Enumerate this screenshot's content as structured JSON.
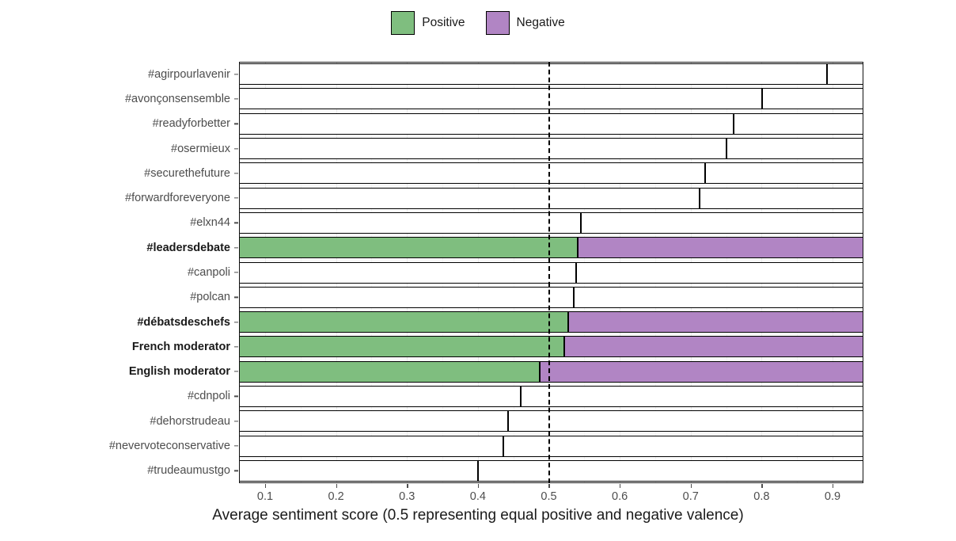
{
  "legend": {
    "items": [
      {
        "label": "Positive",
        "color": "#7fbe7f",
        "key": "positive-key"
      },
      {
        "label": "Negative",
        "color": "#b185c4",
        "key": "negative-key"
      }
    ]
  },
  "axis": {
    "x_title": "Average sentiment score (0.5 representing equal positive and negative valence)",
    "x_ticks": [
      "0.1",
      "0.2",
      "0.3",
      "0.4",
      "0.5",
      "0.6",
      "0.7",
      "0.8",
      "0.9"
    ],
    "x_tick_values": [
      0.1,
      0.2,
      0.3,
      0.4,
      0.5,
      0.6,
      0.7,
      0.8,
      0.9
    ],
    "x_min": 0.0632,
    "x_max": 0.9435,
    "reference_line": 0.5
  },
  "chart_data": {
    "type": "bar",
    "orientation": "horizontal",
    "stacked": true,
    "title": "",
    "subtitle": "",
    "xlabel": "Average sentiment score (0.5 representing equal positive and negative valence)",
    "ylabel": "",
    "xlim": [
      0.0632,
      0.9435
    ],
    "grid": true,
    "legend_position": "top",
    "annotations": [
      {
        "type": "vline",
        "value": 0.5,
        "style": "dashed",
        "color": "#000000"
      }
    ],
    "categories": [
      "#agirpourlavenir",
      "#avonçonsensemble",
      "#readyforbetter",
      "#osermieux",
      "#securethefuture",
      "#forwardforeveryone",
      "#elxn44",
      "#leadersdebate",
      "#canpoli",
      "#polcan",
      "#débatsdeschefs",
      "French moderator",
      "English moderator",
      "#cdnpoli",
      "#dehorstrudeau",
      "#nevervoteconservative",
      "#trudeaumustgo"
    ],
    "series": [
      {
        "name": "Positive",
        "color": "#7fbe7f",
        "values": [
          0.892,
          0.801,
          0.76,
          0.75,
          0.72,
          0.713,
          0.545,
          0.541,
          0.539,
          0.535,
          0.527,
          0.522,
          0.487,
          0.46,
          0.443,
          0.436,
          0.4
        ]
      },
      {
        "name": "Negative",
        "color": "#b185c4",
        "values": [
          0.108,
          0.199,
          0.24,
          0.25,
          0.28,
          0.287,
          0.455,
          0.459,
          0.461,
          0.465,
          0.473,
          0.478,
          0.513,
          0.54,
          0.557,
          0.564,
          0.6
        ]
      }
    ],
    "highlighted_categories": [
      "#leadersdebate",
      "#débatsdeschefs",
      "French moderator",
      "English moderator"
    ]
  }
}
